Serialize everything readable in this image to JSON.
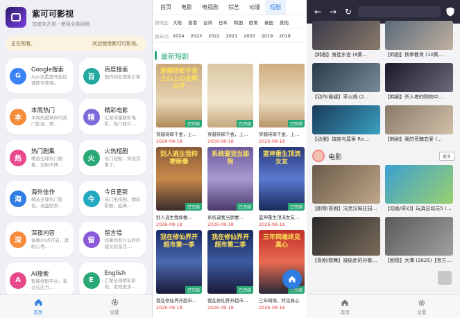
{
  "app": {
    "title": "紫可可影视",
    "subtitle": "加速未开启 · 使用全能网络"
  },
  "notice": {
    "left": "正在观看。",
    "right": "欢迎使用紫可可影视。"
  },
  "cards": [
    {
      "name": "Google搜索",
      "desc": "App设置里开启加速即可使用。",
      "glyph": "G",
      "color": "#3b82f6"
    },
    {
      "name": "百度搜索",
      "desc": "国内知名搜索引擎",
      "glyph": "百",
      "color": "#22a8a0"
    },
    {
      "name": "本周热门",
      "desc": "本周热度飙升的热门影视，精…",
      "glyph": "本",
      "color": "#f58c3b"
    },
    {
      "name": "精彩电影",
      "desc": "汇聚海量精彩电影，热门新片…",
      "glyph": "精",
      "color": "#7c6ad8"
    },
    {
      "name": "热门剧集",
      "desc": "精选全球热门剧集，追剧不停…",
      "glyph": "热",
      "color": "#e8498b"
    },
    {
      "name": "火热短剧",
      "desc": "热门短剧，爽就完事了。",
      "glyph": "火",
      "color": "#2aa876"
    },
    {
      "name": "海外佳作",
      "desc": "精选全球热门影视，涵盖欧美…",
      "glyph": "海",
      "color": "#2f7de1"
    },
    {
      "name": "今日更新",
      "desc": "热门电视剧、精彩影剧，经典…",
      "glyph": "今",
      "color": "#22a8c0"
    },
    {
      "name": "深夜内容",
      "desc": "每晚20点开启，请耐心等…",
      "glyph": "深",
      "color": "#f58c3b"
    },
    {
      "name": "留言墙",
      "desc": "如果你有什么好的建议就留言…",
      "glyph": "留",
      "color": "#8a5ad8"
    },
    {
      "name": "AI搜索",
      "desc": "智能搜剧平台，看过无压力…",
      "glyph": "A",
      "color": "#e8498b"
    },
    {
      "name": "English",
      "desc": "汇聚全球精彩影视，发现更多…",
      "glyph": "E",
      "color": "#2aa876"
    }
  ],
  "tabs1": {
    "home": "首页",
    "settings": "设置"
  },
  "nav": [
    "首页",
    "电影",
    "电视剧",
    "综艺",
    "动漫",
    "短剧"
  ],
  "filters": {
    "region_label": "按地区:",
    "regions": [
      "大陆",
      "香港",
      "台湾",
      "日本",
      "韩国",
      "欧美",
      "泰国",
      "其他"
    ],
    "year_label": "按年代:",
    "years": [
      "2024",
      "2023",
      "2022",
      "2021",
      "2020",
      "2019",
      "2018"
    ]
  },
  "section": {
    "title": "最新短剧"
  },
  "shorts": [
    {
      "title": "穿越侍郎千金，上…",
      "date": "2026-08-18",
      "badge": "已完结",
      "poster": "穿越侍郎千金上心上心全网公开",
      "bg": "linear-gradient(180deg,#caa97a,#e8d6b4 60%,#b08a5a)"
    },
    {
      "title": "穿越侍郎千金，上…",
      "date": "2026-08-18",
      "badge": "已完结",
      "poster": "",
      "bg": "linear-gradient(180deg,#dbc8a4,#f0e4cc 60%,#c7a87c)"
    },
    {
      "title": "穿越侍郎千金，上…",
      "date": "2026-08-18",
      "badge": "已完结",
      "poster": "",
      "bg": "linear-gradient(180deg,#cfae80,#ecdcc0 60%,#b89468)"
    },
    {
      "title": "别人逃生我抑梗…",
      "date": "2026-08-18",
      "badge": "已完结",
      "poster": "别人逃生我抑梗新春",
      "bg": "linear-gradient(180deg,#8a5a3a,#c78a4a 50%,#3a2a2a)"
    },
    {
      "title": "系统逼我当舔妻…",
      "date": "2026-08-18",
      "badge": "已完结",
      "poster": "系统逼我当舔狗",
      "bg": "linear-gradient(180deg,#6a5a9a,#a89ad0 50%,#4a3a6a)"
    },
    {
      "title": "篮神重生顶流女友…",
      "date": "2026-08-18",
      "badge": "已完结",
      "poster": "篮神重生顶流女友",
      "bg": "linear-gradient(180deg,#2a3a7a,#5a7ad0 50%,#1a2a5a)"
    },
    {
      "title": "我在修仙界开超市…",
      "date": "2026-08-18",
      "badge": "已完结",
      "poster": "我在修仙界开超市第一季",
      "bg": "linear-gradient(180deg,#1a2a6a,#4a6ab0 50%,#1a1a3a)"
    },
    {
      "title": "我在修仙界开超市…",
      "date": "2026-08-18",
      "badge": "已完结",
      "poster": "我在修仙界开超市第二季",
      "bg": "linear-gradient(180deg,#1a2a5a,#3a5aa0 50%,#1a1a3a)"
    },
    {
      "title": "三年网缘，终见真心",
      "date": "2026-08-18",
      "badge": "已完结",
      "poster": "三年网缘终见真心",
      "bg": "linear-gradient(180deg,#c0302a,#e86a50 50%,#2a2a3a)"
    }
  ],
  "right": {
    "top_videos": [
      {
        "title": "【韩剧】鬼徒东宫 (8集…",
        "bg": "linear-gradient(135deg,#3a3a4a,#8a7a6a)"
      },
      {
        "title": "【韩剧】铁拳教育 (10集…",
        "bg": "linear-gradient(135deg,#5a6a7a,#c0b0a0)"
      },
      {
        "title": "【动作/悬疑】孚火线 (2…",
        "bg": "linear-gradient(135deg,#2a3a4a,#7a8a9a)"
      },
      {
        "title": "【韩剧】杀人者的购物中…",
        "bg": "linear-gradient(135deg,#1a1a2a,#6a6a7a)"
      },
      {
        "title": "【动漫】瑞克与莫蒂 Ric…",
        "bg": "linear-gradient(135deg,#1a3a5a,#3aa0c0)"
      },
      {
        "title": "【韩剧】我的荒糖恋爱 (…",
        "bg": "linear-gradient(135deg,#8a7a6a,#d0c0a8)"
      }
    ],
    "movie_section": "电影",
    "more": "更多",
    "movies": [
      {
        "title": "【剧情/喜剧】法克汉姆庄园…",
        "bg": "linear-gradient(135deg,#6a5a4a,#c0a888)"
      },
      {
        "title": "【动画/奇幻】玩具总动员5 (…",
        "bg": "linear-gradient(135deg,#3aa0d0,#9ad070)"
      },
      {
        "title": "【喜剧/欧舞】被偷走的孙歌…",
        "bg": "linear-gradient(135deg,#2a2a2a,#7a6a5a)"
      },
      {
        "title": "【剧情】大潭 (2025)【官方…",
        "bg": "linear-gradient(135deg,#5a5a5a,#a0a0a0)"
      }
    ],
    "tabs": {
      "home": "首页",
      "settings": "设置"
    }
  }
}
